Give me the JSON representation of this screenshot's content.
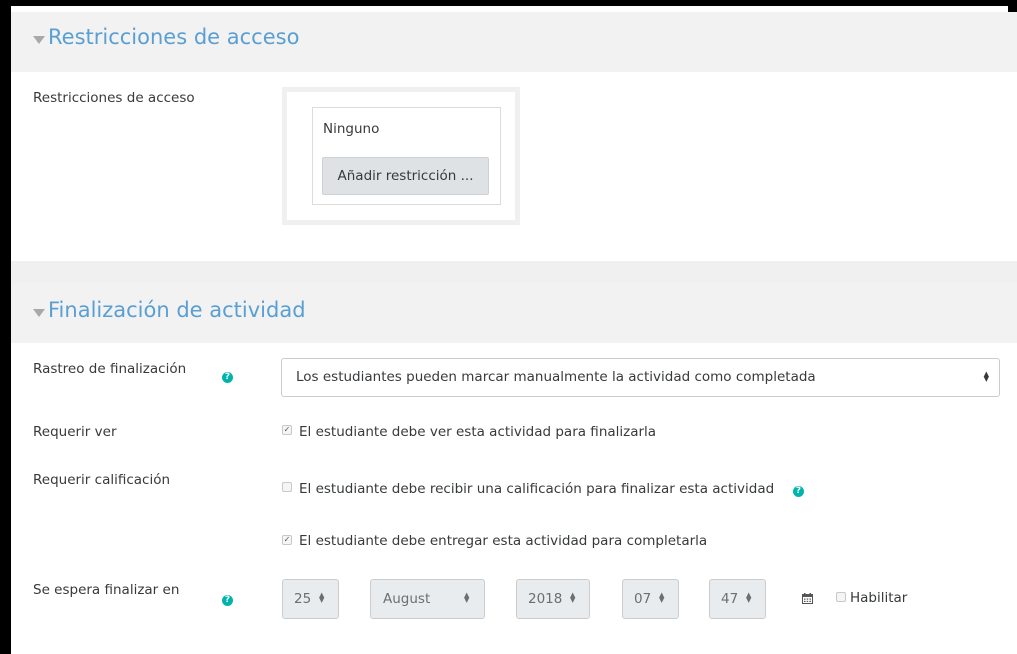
{
  "section_access": {
    "title": "Restricciones de acceso",
    "field_label": "Restricciones de acceso",
    "none_text": "Ninguno",
    "add_button": "Añadir restricción ..."
  },
  "section_completion": {
    "title": "Finalización de actividad",
    "tracking": {
      "label": "Rastreo de finalización",
      "value": "Los estudiantes pueden marcar manualmente la actividad como completada"
    },
    "require_view": {
      "label": "Requerir ver",
      "checkbox_label": "El estudiante debe ver esta actividad para finalizarla",
      "checked": true
    },
    "require_grade": {
      "label": "Requerir calificación",
      "checkbox_label": "El estudiante debe recibir una calificación para finalizar esta actividad",
      "checked": false
    },
    "require_submit": {
      "checkbox_label": "El estudiante debe entregar esta actividad para completarla",
      "checked": true
    },
    "expected": {
      "label": "Se espera finalizar en",
      "day": "25",
      "month": "August",
      "year": "2018",
      "hour": "07",
      "minute": "47",
      "enable_label": "Habilitar",
      "enabled": false
    }
  },
  "icons": {
    "help": "question-circle-icon",
    "collapse": "triangle-down-icon",
    "calendar": "calendar-icon",
    "select_arrows": "updown-arrows-icon"
  },
  "colors": {
    "section_title": "#5a9fd4",
    "section_header_bg": "#f2f2f2",
    "help_icon": "#00b4ab",
    "button_bg": "#dfe2e4"
  }
}
